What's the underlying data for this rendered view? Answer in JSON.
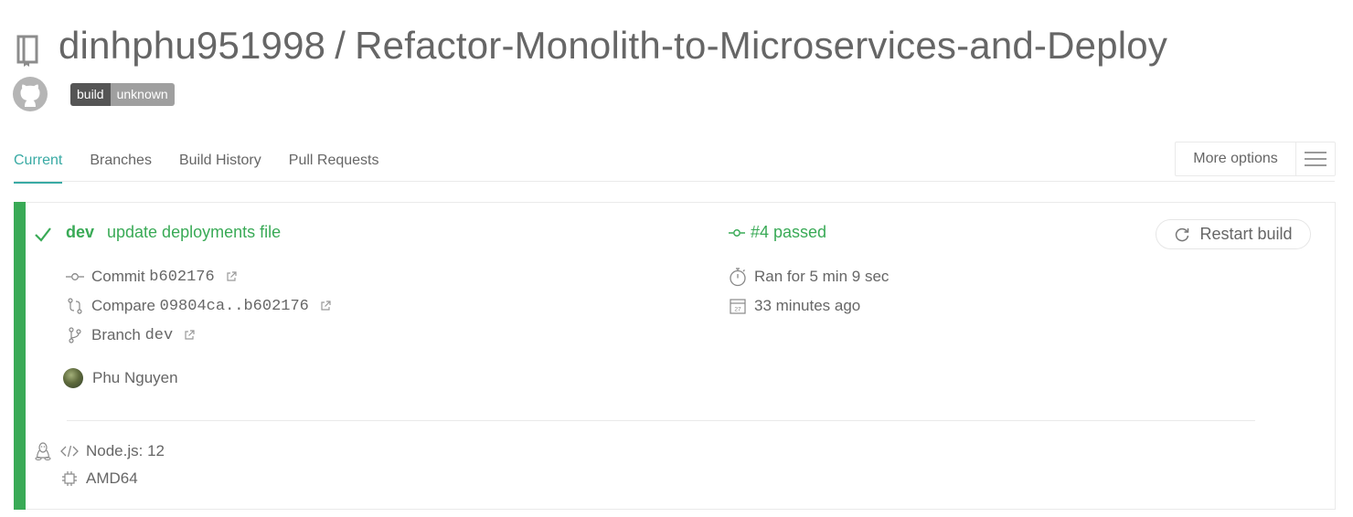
{
  "header": {
    "owner": "dinhphu951998",
    "separator": "/",
    "repo": "Refactor-Monolith-to-Microservices-and-Deploy",
    "badge": {
      "left": "build",
      "right": "unknown"
    }
  },
  "tabs": [
    {
      "label": "Current",
      "active": true
    },
    {
      "label": "Branches",
      "active": false
    },
    {
      "label": "Build History",
      "active": false
    },
    {
      "label": "Pull Requests",
      "active": false
    }
  ],
  "more_options": {
    "label": "More options"
  },
  "build": {
    "branch": "dev",
    "message": "update deployments file",
    "status": "#4 passed",
    "restart_label": "Restart build",
    "commit_label": "Commit",
    "commit_sha": "b602176",
    "compare_label": "Compare",
    "compare_range": "09804ca..b602176",
    "branch_label": "Branch",
    "branch_value": "dev",
    "duration": "Ran for 5 min 9 sec",
    "finished": "33 minutes ago",
    "author": "Phu Nguyen",
    "language": "Node.js: 12",
    "arch": "AMD64",
    "calendar_day": "27"
  },
  "colors": {
    "passed": "#39aa56",
    "active_tab": "#39aaa4",
    "text": "#666666",
    "badge_dark": "#555555",
    "badge_light": "#9f9f9f"
  },
  "icons": [
    "repo-icon",
    "github-icon",
    "check-icon",
    "commit-icon",
    "compare-icon",
    "branch-icon",
    "external-link-icon",
    "stopwatch-icon",
    "calendar-icon",
    "restart-icon",
    "linux-icon",
    "code-icon",
    "cpu-icon",
    "hamburger-icon"
  ]
}
